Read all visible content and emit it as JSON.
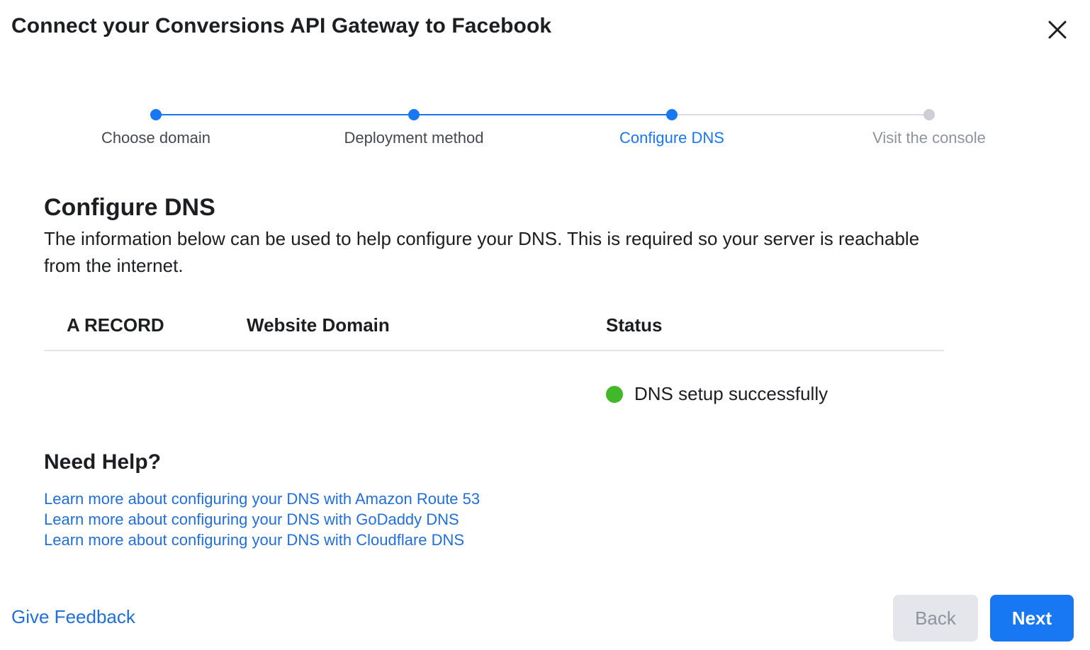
{
  "dialog": {
    "title": "Connect your Conversions API Gateway to Facebook",
    "close_icon": "close-icon"
  },
  "stepper": {
    "steps": [
      {
        "label": "Choose domain",
        "state": "done"
      },
      {
        "label": "Deployment method",
        "state": "done"
      },
      {
        "label": "Configure DNS",
        "state": "active"
      },
      {
        "label": "Visit the console",
        "state": "todo"
      }
    ]
  },
  "section": {
    "title": "Configure DNS",
    "description": "The information below can be used to help configure your DNS. This is required so your server is reachable from the internet."
  },
  "table": {
    "headers": [
      "A RECORD",
      "Website Domain",
      "Status"
    ],
    "rows": [
      {
        "a_record": "",
        "website_domain": "",
        "status": "DNS setup successfully"
      }
    ]
  },
  "help": {
    "title": "Need Help?",
    "links": [
      "Learn more about configuring your DNS with Amazon Route 53",
      "Learn more about configuring your DNS with GoDaddy DNS",
      "Learn more about configuring your DNS with Cloudflare DNS"
    ]
  },
  "footer": {
    "feedback_label": "Give Feedback",
    "back_label": "Back",
    "next_label": "Next"
  },
  "colors": {
    "accent": "#1877f2",
    "success": "#42b72a",
    "link": "#216fdb",
    "inactive": "#ccd0d5"
  }
}
